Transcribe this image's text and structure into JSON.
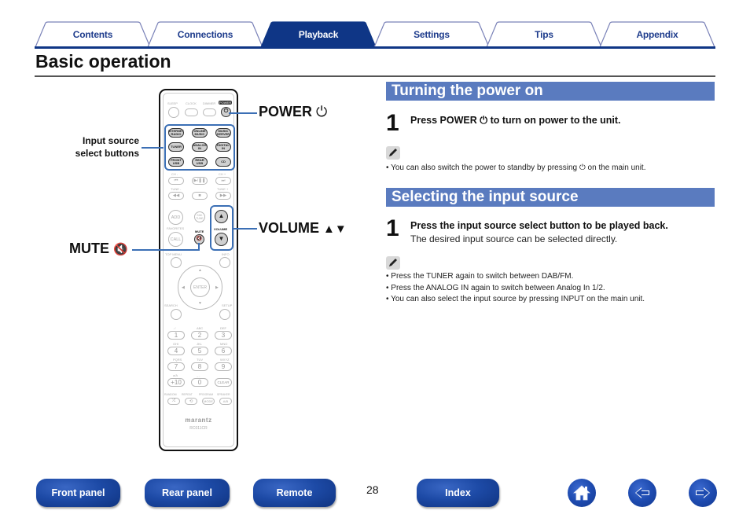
{
  "tabs": [
    {
      "label": "Contents",
      "active": false
    },
    {
      "label": "Connections",
      "active": false
    },
    {
      "label": "Playback",
      "active": true
    },
    {
      "label": "Settings",
      "active": false
    },
    {
      "label": "Tips",
      "active": false
    },
    {
      "label": "Appendix",
      "active": false
    }
  ],
  "colors": {
    "tab_active": "#0f3686",
    "tab_border": "#7a82b8",
    "section_bar": "#5a7bbf",
    "callout": "#3b6fb5",
    "nav_button": "#1d4aa6"
  },
  "page_title": "Basic operation",
  "remote": {
    "callouts": {
      "input_source": [
        "Input source",
        "select buttons"
      ],
      "power": "POWER",
      "volume": "VOLUME",
      "mute": "MUTE"
    },
    "top_labels": [
      "SLEEP",
      "CLOCK",
      "DIMMER",
      "POWER"
    ],
    "source_buttons": [
      "INTERNET RADIO",
      "ONLINE MUSIC",
      "MUSIC SERVER",
      "TUNER",
      "ANALOG IN",
      "DIGITAL IN",
      "FRONT USB",
      "REAR USB",
      "CD"
    ],
    "transport_labels": [
      "CH -",
      "CH +",
      "TUNE -",
      "TUNE +"
    ],
    "transport_buttons": [
      "⏮",
      "▶/❚❚",
      "⏭",
      "◀◀",
      "■",
      "▶▶"
    ],
    "fav_labels": {
      "add": "ADD",
      "sim_tune": "SIM. TUNE",
      "favorites": "FAVORITES",
      "call": "CALL",
      "mute": "MUTE",
      "volume": "VOLUME"
    },
    "nav_labels": {
      "top_menu": "TOP MENU",
      "info": "INFO",
      "enter": "ENTER",
      "search": "SEARCH",
      "setup": "SETUP"
    },
    "keypad": [
      {
        "sub": ". /",
        "num": "1"
      },
      {
        "sub": "ABC",
        "num": "2"
      },
      {
        "sub": "DEF",
        "num": "3"
      },
      {
        "sub": "GHI",
        "num": "4"
      },
      {
        "sub": "JKL",
        "num": "5"
      },
      {
        "sub": "MNO",
        "num": "6"
      },
      {
        "sub": "PQRS",
        "num": "7"
      },
      {
        "sub": "TUV",
        "num": "8"
      },
      {
        "sub": "WXYZ",
        "num": "9"
      },
      {
        "sub": "a/A",
        "num": "+10"
      },
      {
        "sub": "_ ,",
        "num": "0"
      },
      {
        "sub": "",
        "num": "CLEAR"
      }
    ],
    "mode_labels": [
      "RANDOM",
      "REPEAT",
      "PROGRAM",
      "SPEAKER"
    ],
    "mode_buttons": [
      "⤮",
      "⟲",
      "MODE",
      "A/B"
    ],
    "brand": "marantz",
    "model": "RC011CR"
  },
  "sections": [
    {
      "title": "Turning the power on",
      "step_number": "1",
      "step_text": "Press POWER ⏻ to turn on power to the unit.",
      "notes": [
        "• You can also switch the power to standby by pressing ⏻ on the main unit."
      ]
    },
    {
      "title": "Selecting the input source",
      "step_number": "1",
      "step_text": "Press the input source select button to be played back.",
      "step_sub": "The desired input source can be selected directly.",
      "notes": [
        "• Press the TUNER again to switch between DAB/FM.",
        "• Press the ANALOG IN again to switch between Analog In 1/2.",
        "• You can also select the input source by pressing INPUT on the main unit."
      ]
    }
  ],
  "footer": {
    "buttons": [
      "Front panel",
      "Rear panel",
      "Remote",
      "Index"
    ],
    "page_number": "28",
    "icons": [
      "home-icon",
      "back-arrow-icon",
      "forward-arrow-icon"
    ]
  }
}
